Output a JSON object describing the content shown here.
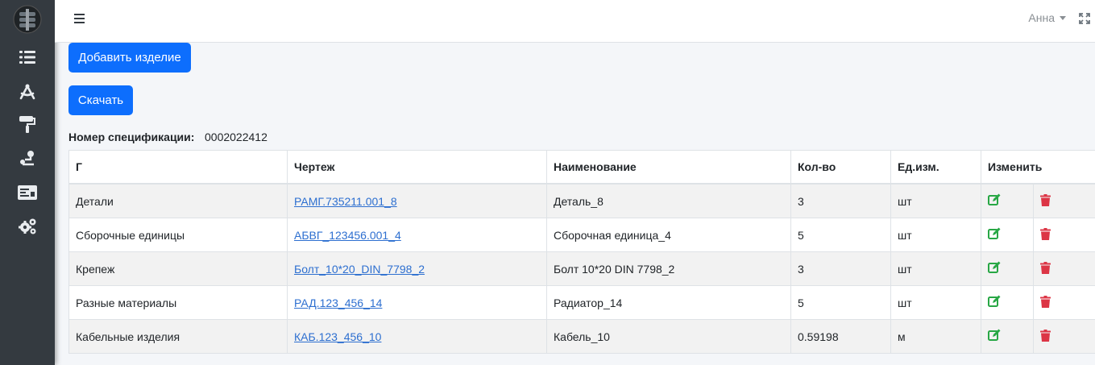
{
  "colors": {
    "sidebar": "#343a40",
    "primary": "#0d6efd",
    "edit": "#28a745",
    "delete": "#dc3545",
    "link": "#2d6fd0"
  },
  "sidebar": {
    "items": [
      {
        "icon": "list-icon"
      },
      {
        "icon": "drafting-compass-icon"
      },
      {
        "icon": "paint-roller-icon"
      },
      {
        "icon": "route-icon"
      },
      {
        "icon": "money-check-icon"
      },
      {
        "icon": "gears-icon"
      }
    ]
  },
  "navbar": {
    "user_name": "Анна"
  },
  "buttons": {
    "add_label": "Добавить изделие",
    "download_label": "Скачать"
  },
  "spec": {
    "label": "Номер спецификации:",
    "number": "0002022412"
  },
  "table": {
    "headers": [
      "Г",
      "Чертеж",
      "Наименование",
      "Кол-во",
      "Ед.изм.",
      "Изменить"
    ],
    "rows": [
      {
        "group": "Детали",
        "drawing": "РАМГ.735211.001_8",
        "name": "Деталь_8",
        "qty": "3",
        "unit": "шт"
      },
      {
        "group": "Сборочные единицы",
        "drawing": "АБВГ_123456.001_4",
        "name": "Сборочная единица_4",
        "qty": "5",
        "unit": "шт"
      },
      {
        "group": "Крепеж",
        "drawing": "Болт_10*20_DIN_7798_2",
        "name": "Болт 10*20 DIN 7798_2",
        "qty": "3",
        "unit": "шт"
      },
      {
        "group": "Разные материалы",
        "drawing": "РАД.123_456_14",
        "name": "Радиатор_14",
        "qty": "5",
        "unit": "шт"
      },
      {
        "group": "Кабельные изделия",
        "drawing": "КАБ.123_456_10",
        "name": "Кабель_10",
        "qty": "0.59198",
        "unit": "м"
      }
    ]
  }
}
